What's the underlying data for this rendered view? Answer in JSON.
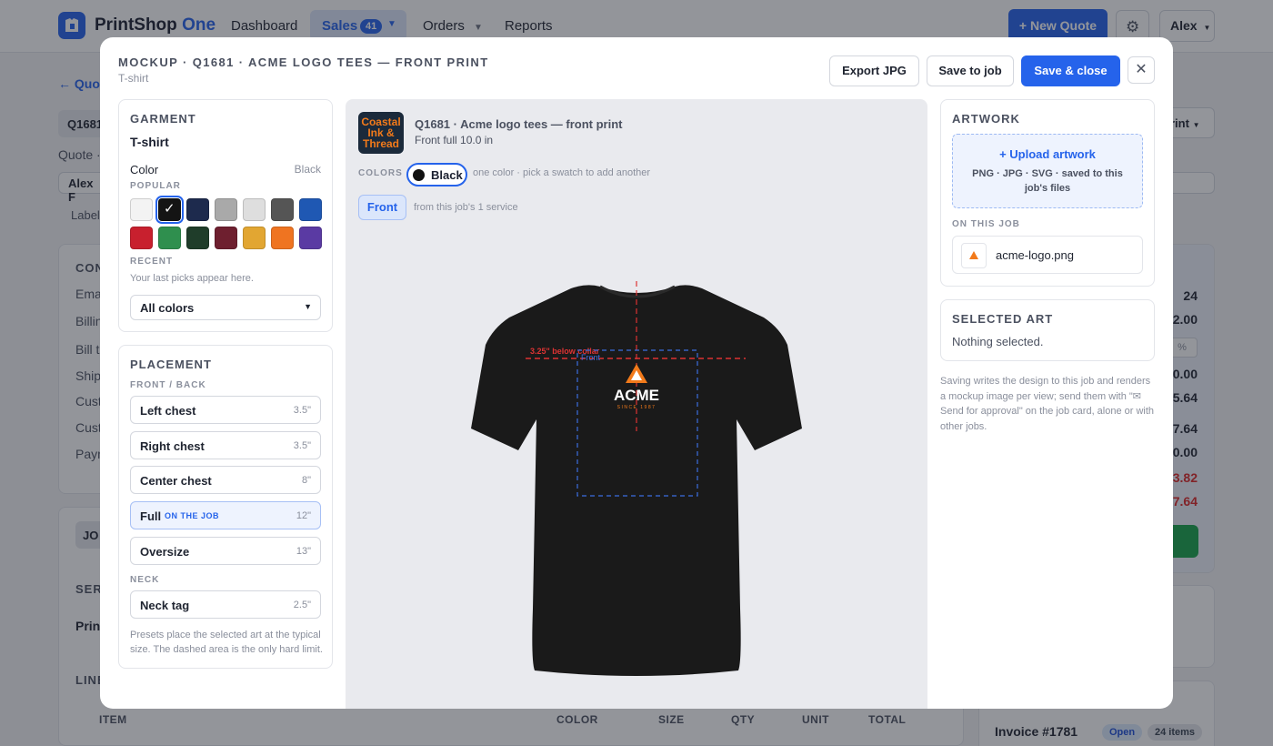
{
  "app": {
    "brand_name": "PrintShop",
    "brand_accent": "One",
    "nav": {
      "dashboard": "Dashboard",
      "sales": "Sales",
      "sales_badge": "41",
      "orders": "Orders",
      "reports": "Reports"
    },
    "new_quote_label": "+ New Quote",
    "user_label": "Alex",
    "accent_color": "#2563eb"
  },
  "background": {
    "back_link": "← Quot",
    "quote_chip": "Q1681",
    "quote_meta": "Quote · ",
    "customer_field": "Alex F",
    "labels_text": "Label",
    "contact_head": "CON",
    "contact_rows": [
      "Ema",
      "Billin",
      "Bill to",
      "Ship",
      "Cust",
      "Cust",
      "Payn"
    ],
    "jobs_tab": "JO",
    "services_head": "SER",
    "print_row": "Print",
    "line_head": "LINE",
    "right_select": "rint",
    "totals": [
      "24",
      "2.00",
      "%",
      "0.00",
      "5.64",
      "7.64",
      "0.00",
      "3.82",
      "7.64"
    ],
    "table_headers": [
      "ITEM",
      "COLOR",
      "SIZE",
      "QTY",
      "UNIT",
      "TOTAL"
    ],
    "invoice_label": "Invoice #1781",
    "invoice_status": "Open",
    "invoice_items": "24 items"
  },
  "modal": {
    "title": "MOCKUP · Q1681 · ACME LOGO TEES — FRONT PRINT",
    "subtitle": "T-shirt",
    "export_label": "Export JPG",
    "save_job_label": "Save to job",
    "save_close_label": "Save & close",
    "close_symbol": "✕"
  },
  "garment": {
    "heading": "GARMENT",
    "name": "T-shirt",
    "color_label": "Color",
    "color_value": "Black",
    "popular_label": "POPULAR",
    "swatches": [
      {
        "name": "white",
        "hex": "#f3f3f3"
      },
      {
        "name": "black",
        "hex": "#141414",
        "selected": true
      },
      {
        "name": "navy",
        "hex": "#1d2a4d"
      },
      {
        "name": "gray",
        "hex": "#a9a9a9"
      },
      {
        "name": "light-gray",
        "hex": "#dedede"
      },
      {
        "name": "charcoal",
        "hex": "#555555"
      },
      {
        "name": "royal-blue",
        "hex": "#1f58b3"
      },
      {
        "name": "red",
        "hex": "#c8202e"
      },
      {
        "name": "kelly-green",
        "hex": "#2f8f4e"
      },
      {
        "name": "forest-green",
        "hex": "#1f3d2a"
      },
      {
        "name": "maroon",
        "hex": "#6e1f2f"
      },
      {
        "name": "gold",
        "hex": "#e2a632"
      },
      {
        "name": "orange",
        "hex": "#ef7421"
      },
      {
        "name": "purple",
        "hex": "#5a3aa3"
      }
    ],
    "recent_label": "RECENT",
    "recent_hint": "Your last picks appear here.",
    "select_value": "All colors"
  },
  "placement": {
    "heading": "PLACEMENT",
    "front_back_label": "FRONT / BACK",
    "items": [
      {
        "name": "Left chest",
        "size": "3.5\""
      },
      {
        "name": "Right chest",
        "size": "3.5\""
      },
      {
        "name": "Center chest",
        "size": "8\""
      },
      {
        "name": "Full",
        "size": "12\"",
        "tag": "ON THE JOB",
        "active": true
      },
      {
        "name": "Oversize",
        "size": "13\""
      }
    ],
    "neck_label": "NECK",
    "neck_item": {
      "name": "Neck tag",
      "size": "2.5\""
    },
    "note": "Presets place the selected art at the typical size. The dashed area is the only hard limit."
  },
  "preview": {
    "shop_logo_lines": [
      "Coastal",
      "Ink &",
      "Thread"
    ],
    "job_title": "Q1681 · Acme logo tees — front print",
    "job_sub": "Front full 10.0 in",
    "colors_label": "COLORS",
    "color_chip": "Black",
    "colors_hint": "one color · pick a swatch to add another",
    "view_label": "Front",
    "view_hint": "from this job's 1 service",
    "collar_guide": "3.25\" below collar",
    "area_label": "Front",
    "logo_text": "ACME",
    "logo_tagline": "SINCE 1987",
    "garment_color": "#1a1a1a"
  },
  "artwork": {
    "heading": "ARTWORK",
    "upload_label": "+ Upload artwork",
    "upload_hint": "PNG · JPG · SVG · saved to this job's files",
    "on_job_label": "ON THIS JOB",
    "file_name": "acme-logo.png"
  },
  "selected_art": {
    "heading": "SELECTED ART",
    "text": "Nothing selected."
  },
  "save_note": "Saving writes the design to this job and renders a mockup image per view; send them with \"✉ Send for approval\" on the job card, alone or with other jobs."
}
